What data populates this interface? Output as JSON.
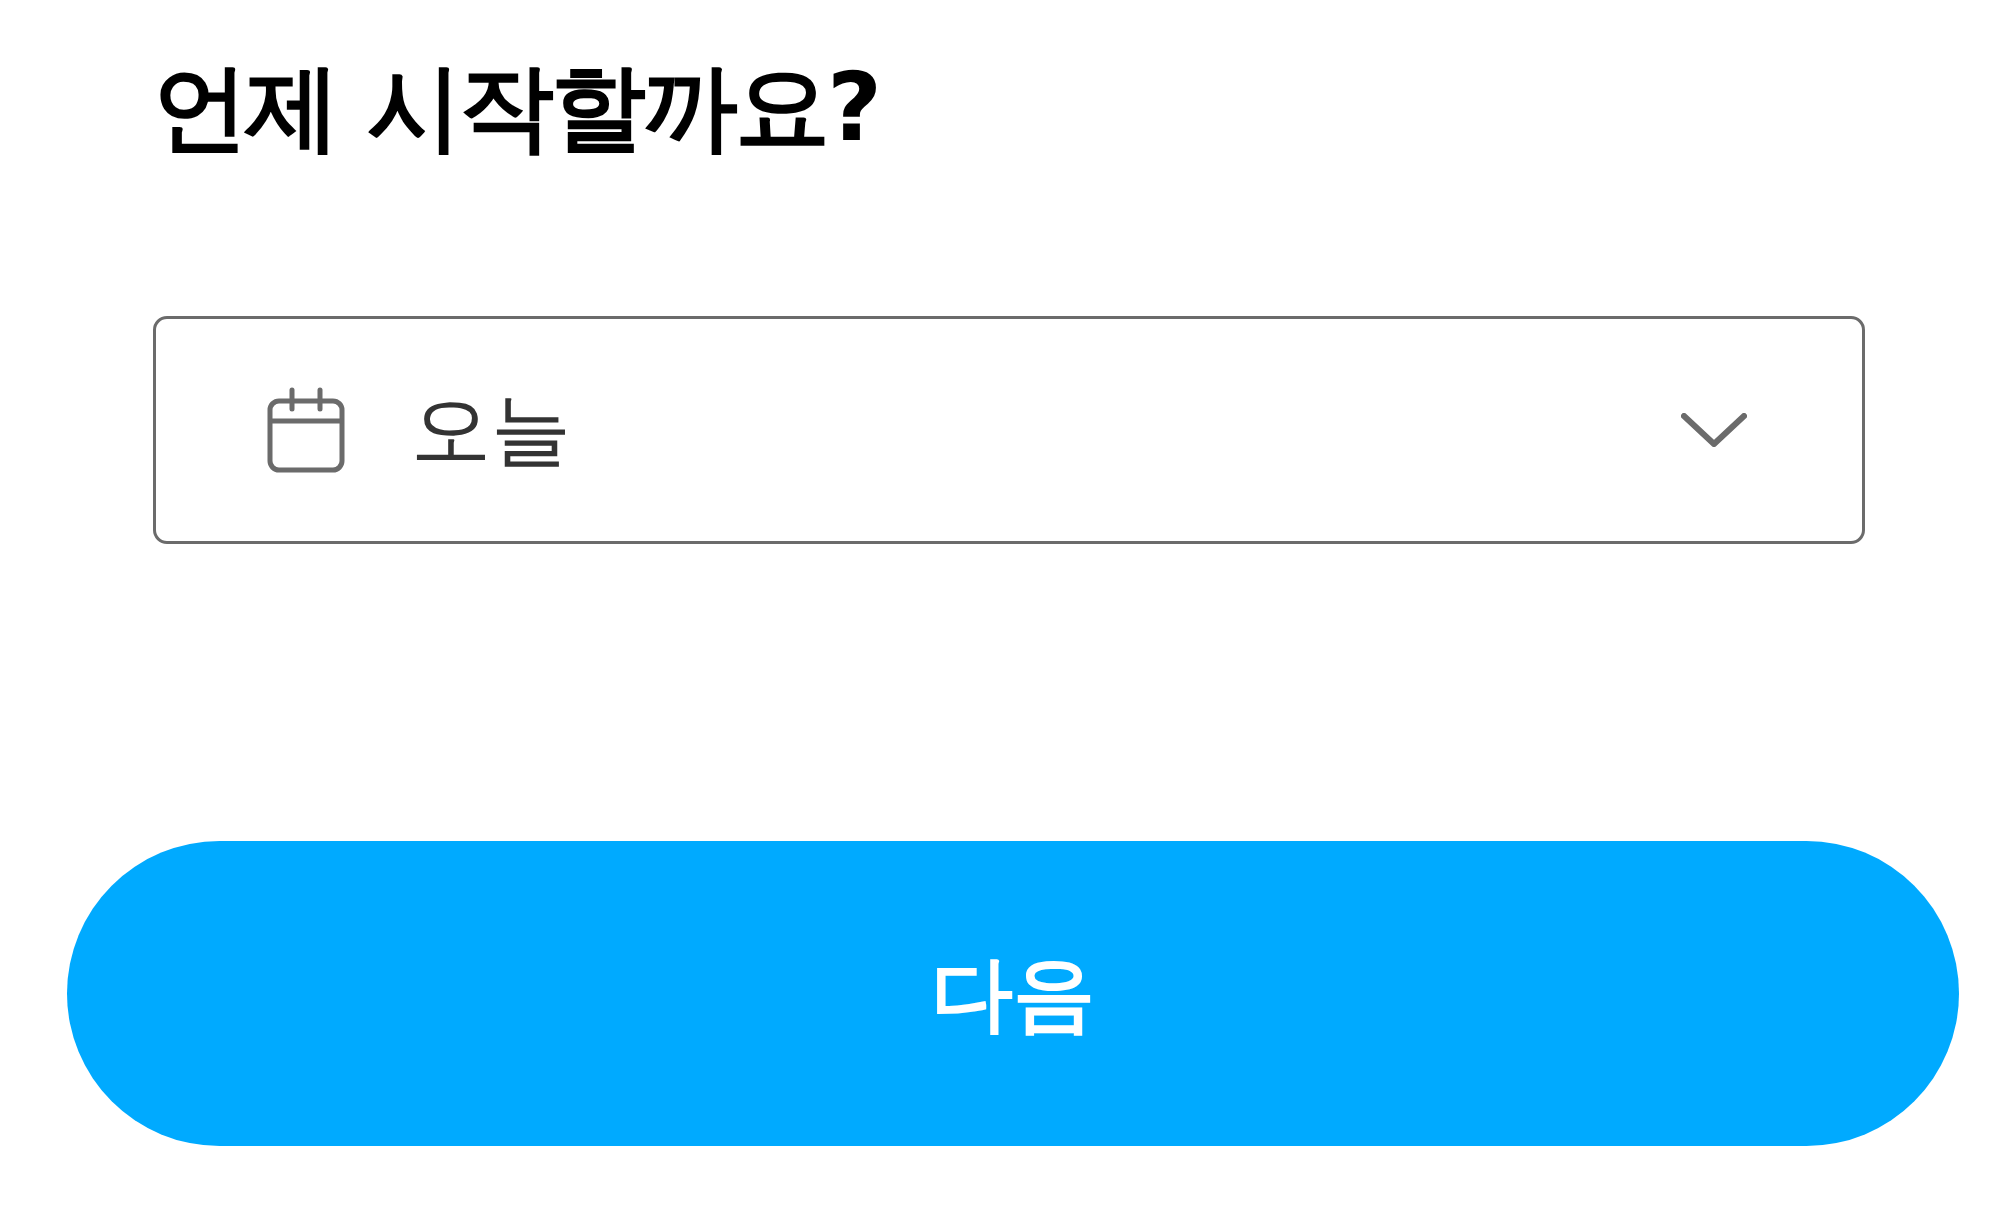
{
  "heading": "언제 시작할까요?",
  "start_select": {
    "value": "오늘"
  },
  "next_button": {
    "label": "다음"
  }
}
